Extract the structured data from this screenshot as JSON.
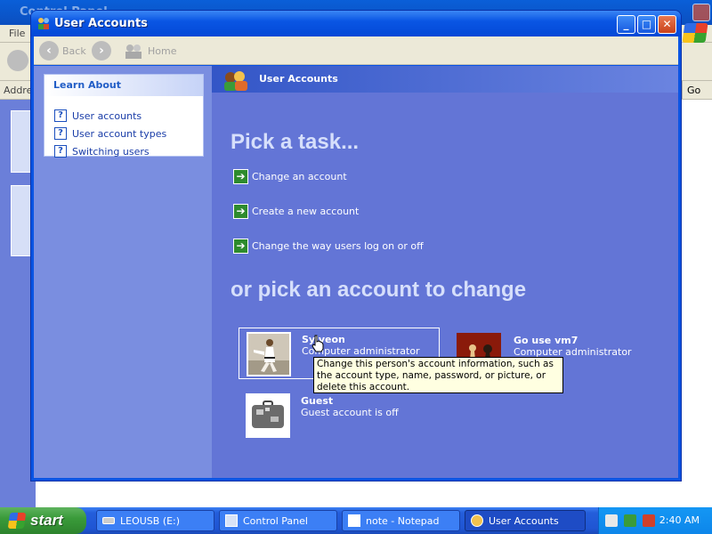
{
  "background_window": {
    "title": "Control Panel",
    "menu_file": "File",
    "address_label": "Address",
    "go_label": "Go"
  },
  "window": {
    "title": "User Accounts",
    "controls": {
      "minimize": "_",
      "maximize": "□",
      "close": "✕"
    }
  },
  "toolbar": {
    "back_label": "Back",
    "home_label": "Home"
  },
  "learn_about": {
    "header": "Learn About",
    "items": [
      "User accounts",
      "User account types",
      "Switching users"
    ]
  },
  "main": {
    "header": "User Accounts",
    "pick_task_heading": "Pick a task...",
    "tasks": [
      "Change an account",
      "Create a new account",
      "Change the way users log on or off"
    ],
    "pick_account_heading": "or pick an account to change",
    "accounts": [
      {
        "name": "Sylveon",
        "role": "Computer administrator"
      },
      {
        "name": "Go use vm7",
        "role": "Computer administrator"
      },
      {
        "name": "Guest",
        "role": "Guest account is off"
      }
    ],
    "tooltip": "Change this person's account information, such as the account type, name, password, or picture, or delete this account."
  },
  "taskbar": {
    "start_label": "start",
    "items": [
      "LEOUSB (E:)",
      "Control Panel",
      "note - Notepad",
      "User Accounts"
    ],
    "clock": "2:40 AM"
  },
  "colors": {
    "title_bar": "#0a56e4",
    "content_bg": "#6375d6",
    "left_pane_bg": "#7a8ee0",
    "taskbar": "#245edb",
    "start_button": "#3a9b3a"
  }
}
